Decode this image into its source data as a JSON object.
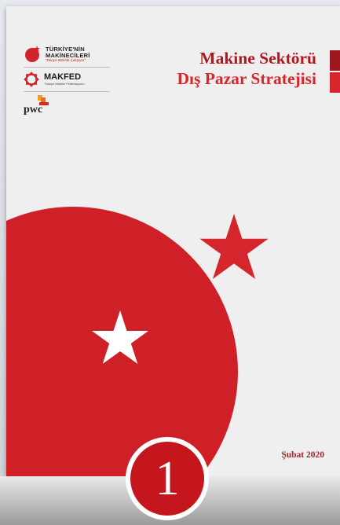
{
  "logos": {
    "tm": {
      "line1": "TÜRKİYE'NİN",
      "line2": "MAKİNECİLERİ",
      "slogan": "\"Dünya Bizimle Çalışıyor\""
    },
    "makfed": {
      "name": "MAKFED",
      "subtitle": "Türkiye Makine Federasyonu"
    },
    "pwc": {
      "name": "pwc"
    }
  },
  "title": {
    "line1": "Makine Sektörü",
    "line2": "Dış Pazar Stratejisi"
  },
  "date": "Şubat 2020",
  "badge": {
    "number": "1"
  },
  "colors": {
    "red": "#c4161c",
    "dark_red": "#b5161d",
    "background": "#efefef"
  }
}
